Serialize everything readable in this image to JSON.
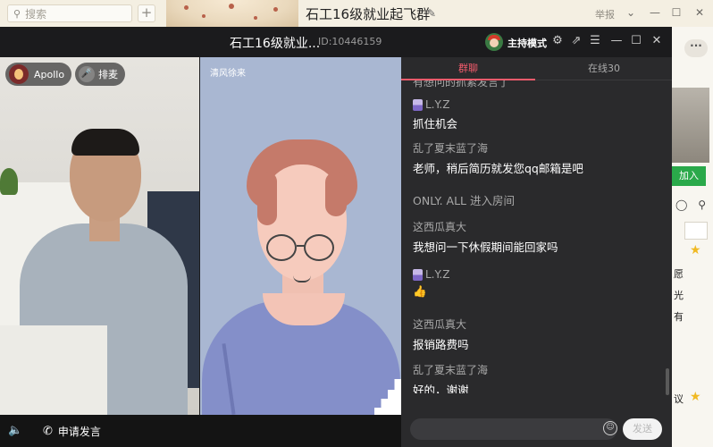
{
  "background_window": {
    "search_placeholder": "搜索",
    "search_icon": "search-icon",
    "add_icon": "plus-icon",
    "group_title": "石工16级就业起飞群",
    "edit_icon": "edit-pencil-icon",
    "report_label": "举报",
    "join_button": "加入",
    "side_fragments": [
      "愿",
      "光",
      "有",
      "议"
    ]
  },
  "live_window": {
    "title": "石工16级就业...",
    "room_id": "ID:10446159",
    "host_mode_label": "主持模式",
    "controls": [
      "settings-icon",
      "popout-icon",
      "menu-icon",
      "minimize-icon",
      "maximize-icon",
      "close-icon"
    ],
    "left_video": {
      "user_name": "Apollo",
      "mic_queue_label": "排麦"
    },
    "mid_video": {
      "user_name": "清风徐来"
    },
    "bottom_bar": {
      "volume_icon": "volume-icon",
      "request_speak_label": "申请发言"
    },
    "chat": {
      "tabs": [
        {
          "label": "群聊",
          "active": true
        },
        {
          "label": "在线30",
          "active": false
        }
      ],
      "cut_message": "有想问的抓紧发言了",
      "messages": [
        {
          "user": "L.Y.Z",
          "text": "抓住机会",
          "badge": true
        },
        {
          "user": "乱了夏末蓝了海",
          "text": "老师，稍后简历就发您qq邮箱是吧",
          "badge": false
        },
        {
          "system": "ONLY.  ALL 进入房间"
        },
        {
          "user": "这西瓜真大",
          "text": "我想问一下休假期间能回家吗",
          "badge": false
        },
        {
          "user": "L.Y.Z",
          "text": "👍",
          "badge": true
        },
        {
          "user": "这西瓜真大",
          "text": "报销路费吗",
          "badge": false
        },
        {
          "user": "乱了夏末蓝了海",
          "text": "好的，谢谢",
          "badge": false
        }
      ],
      "input_placeholder": "",
      "emoji_icon": "emoji-icon",
      "send_label": "发送"
    }
  },
  "colors": {
    "accent": "#f15b6c",
    "chat_bg": "#2a2a2c",
    "join_green": "#2aa94a"
  }
}
